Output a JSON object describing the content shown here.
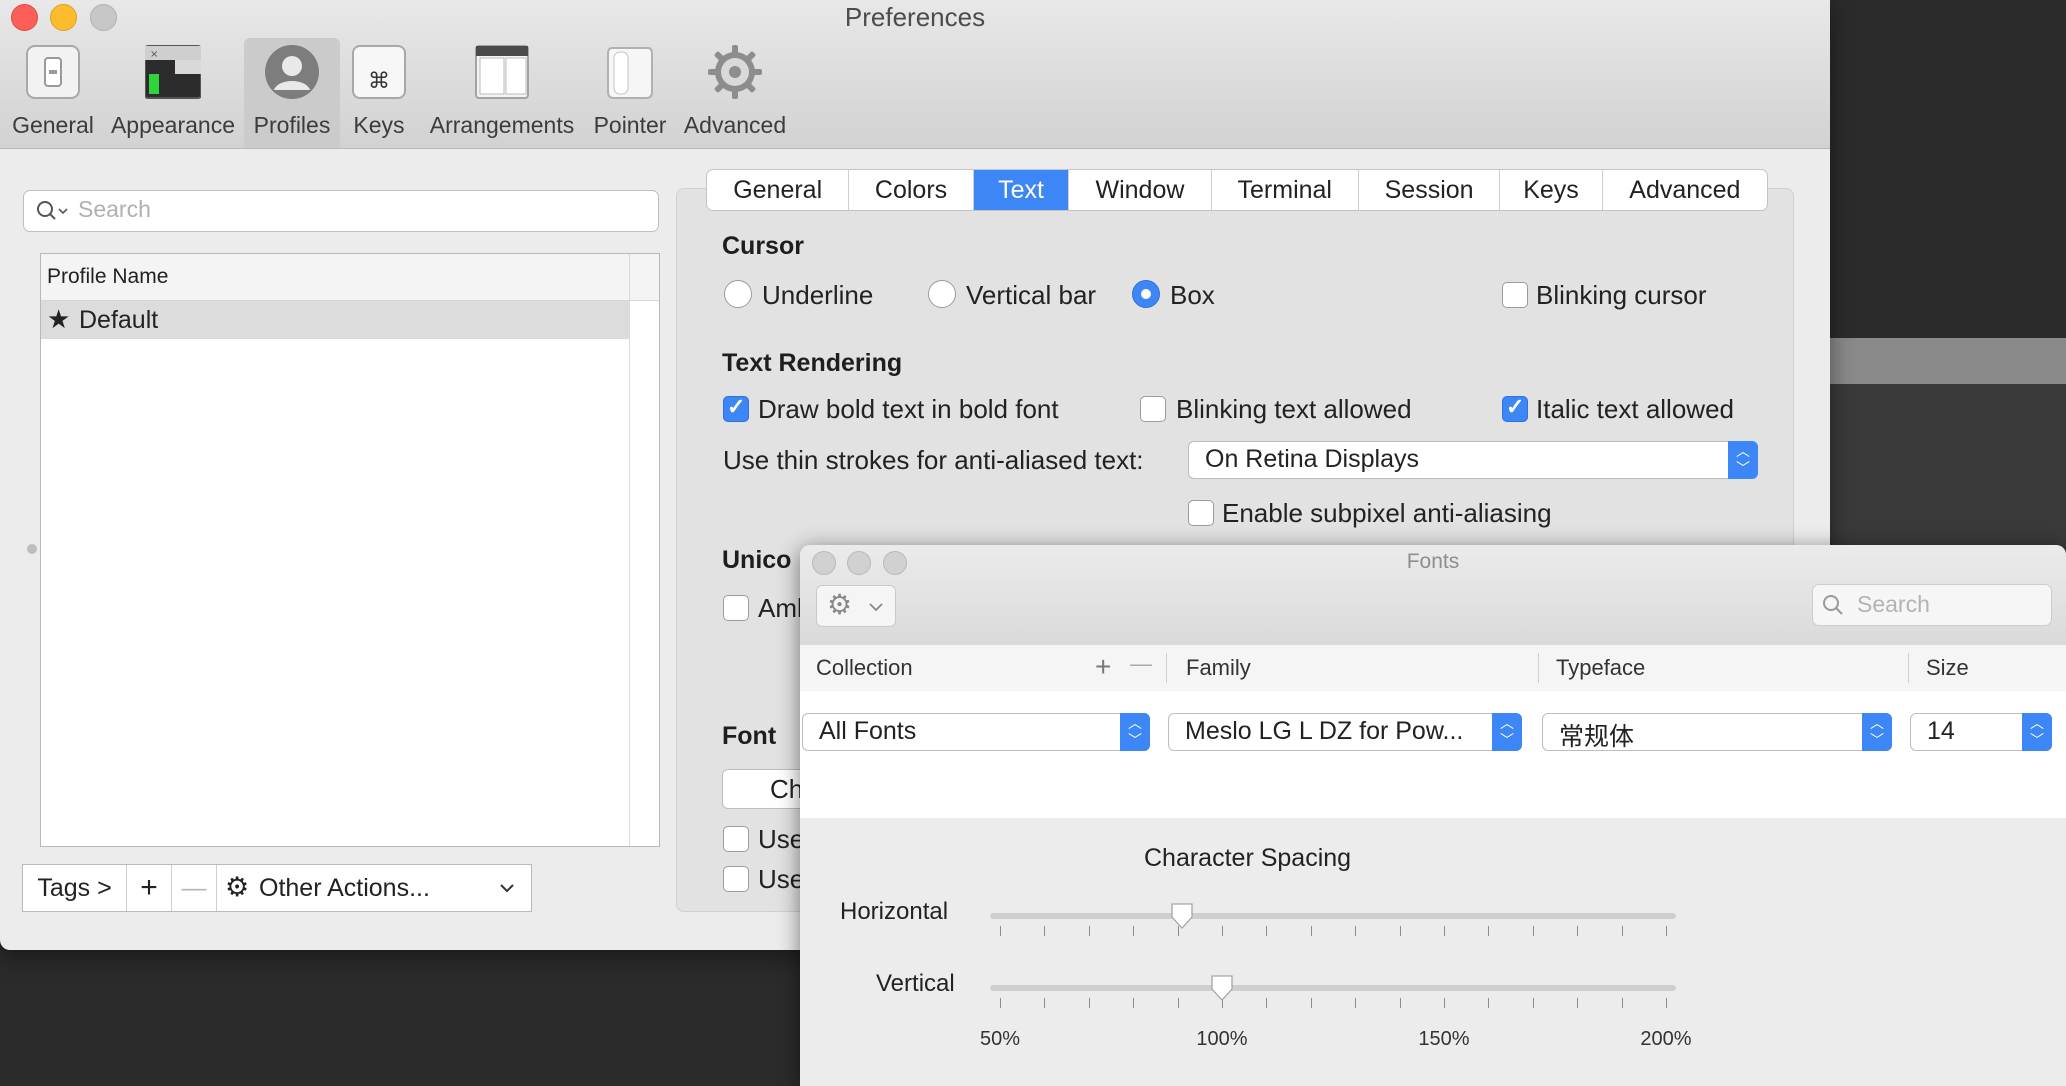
{
  "window": {
    "title": "Preferences"
  },
  "toolbar": {
    "items": [
      {
        "label": "General",
        "icon": "general-switch-icon"
      },
      {
        "label": "Appearance",
        "icon": "appearance-terminal-icon"
      },
      {
        "label": "Profiles",
        "icon": "profile-person-icon"
      },
      {
        "label": "Keys",
        "icon": "command-key-icon"
      },
      {
        "label": "Arrangements",
        "icon": "window-arrangement-icon"
      },
      {
        "label": "Pointer",
        "icon": "mouse-icon"
      },
      {
        "label": "Advanced",
        "icon": "gear-icon"
      }
    ],
    "selected": "Profiles"
  },
  "profiles": {
    "search_placeholder": "Search",
    "column_header": "Profile Name",
    "items": [
      {
        "name": "Default",
        "starred": true
      }
    ],
    "tags_label": "Tags >",
    "add_label": "+",
    "remove_label": "—",
    "other_actions_label": "Other Actions..."
  },
  "tabs": {
    "items": [
      "General",
      "Colors",
      "Text",
      "Window",
      "Terminal",
      "Session",
      "Keys",
      "Advanced"
    ],
    "active": "Text"
  },
  "text_tab": {
    "cursor": {
      "heading": "Cursor",
      "underline": "Underline",
      "vertical_bar": "Vertical bar",
      "box": "Box",
      "selected": "Box",
      "blinking": "Blinking cursor",
      "blinking_checked": false
    },
    "rendering": {
      "heading": "Text Rendering",
      "bold": "Draw bold text in bold font",
      "bold_checked": true,
      "blinking_text": "Blinking text allowed",
      "blinking_text_checked": false,
      "italic": "Italic text allowed",
      "italic_checked": true,
      "thin_strokes_label": "Use thin strokes for anti-aliased text:",
      "thin_strokes_value": "On Retina Displays",
      "subpixel": "Enable subpixel anti-aliasing",
      "subpixel_checked": false
    },
    "unicode": {
      "heading_visible": "Unico",
      "option_visible": "Aml"
    },
    "font": {
      "heading": "Font",
      "change_visible": "Ch",
      "use1_visible": "Use",
      "use2_visible": "Use"
    }
  },
  "fonts_panel": {
    "title": "Fonts",
    "search_placeholder": "Search",
    "headers": {
      "collection": "Collection",
      "family": "Family",
      "typeface": "Typeface",
      "size": "Size"
    },
    "collection_add": "+",
    "collection_remove": "—",
    "collection": "All Fonts",
    "family": "Meslo LG L DZ for Pow...",
    "typeface": "常规体",
    "size": "14",
    "spacing": {
      "heading": "Character Spacing",
      "horizontal_label": "Horizontal",
      "vertical_label": "Vertical",
      "horizontal_value_pct": 91,
      "vertical_value_pct": 100,
      "range_pct": [
        50,
        200
      ],
      "tick_labels": [
        "50%",
        "100%",
        "150%",
        "200%"
      ]
    }
  }
}
